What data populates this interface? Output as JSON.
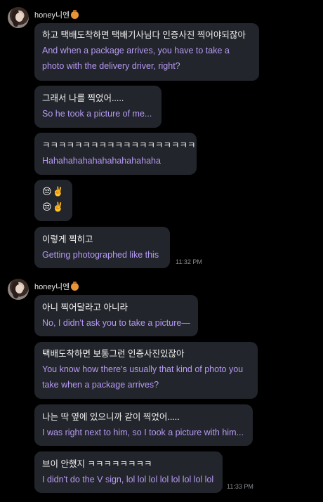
{
  "groups": [
    {
      "sender": "honey니엔",
      "honey_icon": "honey-pot-icon",
      "messages": [
        {
          "ko": "하고 택배도착하면 택배기사님다 인증사진 찍어야되잖아",
          "en": [
            "And when a package arrives, you have to take a",
            "photo with the delivery driver, right?"
          ]
        },
        {
          "ko": "그래서 나를 찍었어.....",
          "en": [
            "So he took a picture of me..."
          ]
        },
        {
          "ko": "ㅋㅋㅋㅋㅋㅋㅋㅋㅋㅋㅋㅋㅋㅋㅋㅋㅋㅋㅋ",
          "en": [
            "Hahahahahahahahahahahaha"
          ]
        },
        {
          "emoji": [
            "😒✌️",
            "😒✌️"
          ]
        },
        {
          "ko": "이렇게 찍히고",
          "en": [
            "Getting photographed like this"
          ]
        }
      ],
      "time": "11:32 PM"
    },
    {
      "sender": "honey니엔",
      "honey_icon": "honey-pot-icon",
      "messages": [
        {
          "ko": "아니 찍어달라고 아니라",
          "en": [
            "No, I didn't ask you to take a picture—"
          ]
        },
        {
          "ko": "택배도착하면 보통그런 인증사진있잖아",
          "en": [
            "You know how there's usually that kind of photo you",
            "take when a package arrives?"
          ]
        },
        {
          "ko": "나는 딱 옆에 있으니까 같이 찍었어.....",
          "en": [
            "I was right next to him, so I took a picture with him..."
          ]
        },
        {
          "ko": "브이 안했지 ㅋㅋㅋㅋㅋㅋㅋㅋ",
          "en": [
            "I didn't do the V sign, lol lol lol lol lol lol lol lol"
          ]
        }
      ],
      "time": "11:33 PM"
    }
  ]
}
